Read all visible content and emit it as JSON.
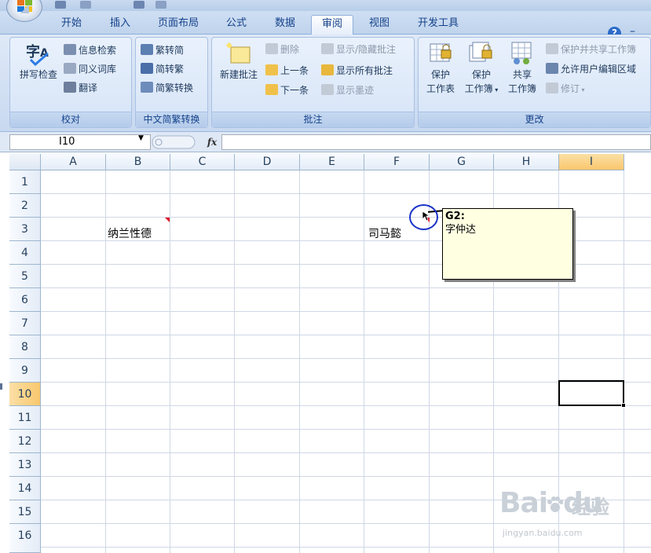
{
  "ribbon_tabs": [
    {
      "label": "开始"
    },
    {
      "label": "插入"
    },
    {
      "label": "页面布局"
    },
    {
      "label": "公式"
    },
    {
      "label": "数据"
    },
    {
      "label": "审阅"
    },
    {
      "label": "视图"
    },
    {
      "label": "开发工具"
    }
  ],
  "active_tab": "审阅",
  "help_label": "?",
  "minimize_label": "–",
  "groups": {
    "proofing": {
      "label": "校对",
      "spell": "拼写检查",
      "research": "信息检索",
      "thesaurus": "同义词库",
      "translate": "翻译"
    },
    "chinese": {
      "label": "中文简繁转换",
      "to_simplified": "繁转简",
      "to_traditional": "简转繁",
      "convert": "简繁转换"
    },
    "comments": {
      "label": "批注",
      "new_comment": "新建批注",
      "delete": "删除",
      "previous": "上一条",
      "next": "下一条",
      "show_hide": "显示/隐藏批注",
      "show_all": "显示所有批注",
      "show_ink": "显示墨迹"
    },
    "changes": {
      "label": "更改",
      "protect_sheet": [
        "保护",
        "工作表"
      ],
      "protect_workbook": [
        "保护",
        "工作簿"
      ],
      "share_workbook": [
        "共享",
        "工作簿"
      ],
      "protect_share": "保护并共享工作簿",
      "allow_edit": "允许用户编辑区域",
      "track": "修订"
    }
  },
  "formula_bar": {
    "name_box": "I10",
    "fx": "fx",
    "formula": ""
  },
  "columns": [
    "A",
    "B",
    "C",
    "D",
    "E",
    "F",
    "G",
    "H",
    "I"
  ],
  "rows": [
    "1",
    "2",
    "3",
    "4",
    "5",
    "6",
    "7",
    "8",
    "9",
    "10",
    "11",
    "12",
    "13",
    "14",
    "15",
    "16"
  ],
  "selected_column": "I",
  "selected_row": "10",
  "cells": {
    "B3": "纳兰性德",
    "F3": "司马懿"
  },
  "comment": {
    "author": "G2:",
    "text": "字仲达"
  },
  "watermark": {
    "main": "Bai",
    "paw": "du",
    "cn": "经验",
    "url": "jingyan.baidu.com"
  },
  "colors": {
    "selection_orange": "#f9c76d",
    "comment_bg": "#ffffe1",
    "indicator_red": "#e0142a",
    "circle_blue": "#1a33c8"
  }
}
